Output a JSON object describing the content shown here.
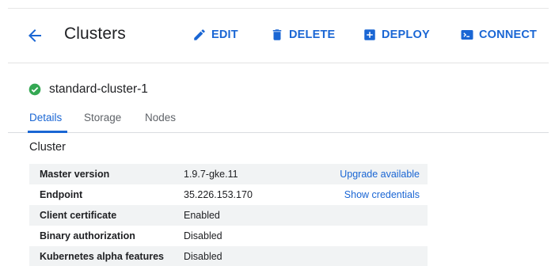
{
  "header": {
    "title": "Clusters",
    "actions": {
      "edit": "EDIT",
      "delete": "DELETE",
      "deploy": "DEPLOY",
      "connect": "CONNECT"
    }
  },
  "cluster": {
    "name": "standard-cluster-1",
    "status": "ok"
  },
  "tabs": [
    "Details",
    "Storage",
    "Nodes"
  ],
  "section": {
    "title": "Cluster"
  },
  "details": [
    {
      "label": "Master version",
      "value": "1.9.7-gke.11",
      "link": "Upgrade available"
    },
    {
      "label": "Endpoint",
      "value": "35.226.153.170",
      "link": "Show credentials"
    },
    {
      "label": "Client certificate",
      "value": "Enabled",
      "link": ""
    },
    {
      "label": "Binary authorization",
      "value": "Disabled",
      "link": ""
    },
    {
      "label": "Kubernetes alpha features",
      "value": "Disabled",
      "link": ""
    }
  ],
  "colors": {
    "accent": "#1a66d4",
    "success": "#34a853",
    "text": "#202124",
    "row_shade": "#f1f3f4"
  },
  "icons": [
    "back-arrow-icon",
    "pencil-icon",
    "trash-icon",
    "plus-box-icon",
    "terminal-icon",
    "check-circle-icon"
  ]
}
